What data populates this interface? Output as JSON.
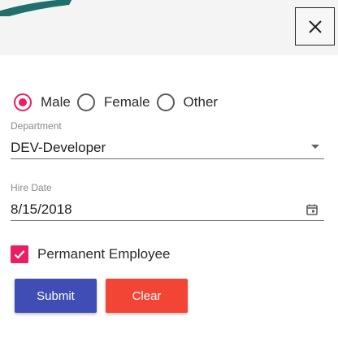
{
  "gender": {
    "options": [
      {
        "label": "Male",
        "selected": true
      },
      {
        "label": "Female",
        "selected": false
      },
      {
        "label": "Other",
        "selected": false
      }
    ]
  },
  "department": {
    "label": "Department",
    "value": "DEV-Developer",
    "icon": "dropdown-arrow-icon"
  },
  "hire_date": {
    "label": "Hire Date",
    "value": "8/15/2018",
    "icon": "calendar-icon"
  },
  "permanent": {
    "label": "Permanent Employee",
    "checked": true
  },
  "buttons": {
    "submit": "Submit",
    "clear": "Clear"
  },
  "colors": {
    "accent": "#e91e63",
    "submit": "#3f4db4",
    "clear": "#f24535",
    "stripe": "#1f6f6a"
  },
  "close_icon": "close-icon"
}
